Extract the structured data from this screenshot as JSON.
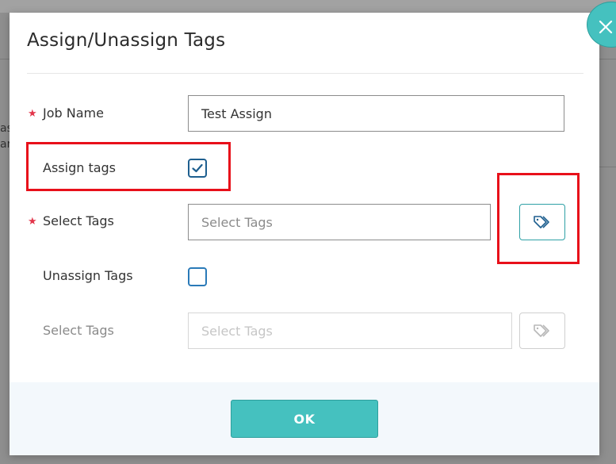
{
  "dialog": {
    "title": "Assign/Unassign Tags",
    "close_icon": "close-icon",
    "ok_label": "OK"
  },
  "form": {
    "job_name": {
      "label": "Job Name",
      "required": true,
      "value": "Test Assign"
    },
    "assign_tags": {
      "label": "Assign tags",
      "checked": true
    },
    "select_tags_assign": {
      "label": "Select Tags",
      "required": true,
      "placeholder": "Select Tags",
      "button_icon": "tag-icon"
    },
    "unassign_tags": {
      "label": "Unassign Tags",
      "checked": false
    },
    "select_tags_unassign": {
      "label": "Select Tags",
      "placeholder": "Select Tags",
      "disabled": true,
      "button_icon": "tag-icon"
    }
  },
  "background": {
    "fragment_lines": [
      "as",
      "ar"
    ]
  },
  "colors": {
    "accent": "#45c1bf",
    "required_star": "#e2354a",
    "highlight": "#e8101a",
    "checkbox_border": "#1e5f8f"
  }
}
